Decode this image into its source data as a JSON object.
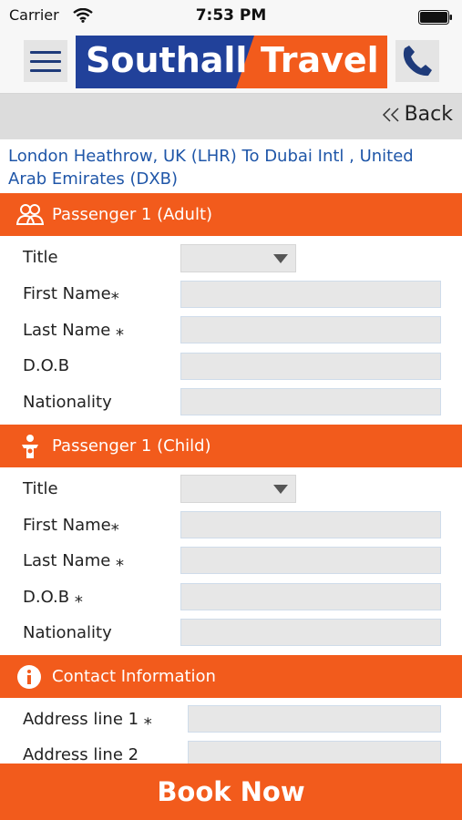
{
  "status_bar": {
    "carrier": "Carrier",
    "time": "7:53 PM"
  },
  "header": {
    "logo_word_1": "Southall",
    "logo_word_2": "Travel",
    "colors": {
      "brand_blue": "#21419a",
      "brand_orange": "#f25b1c"
    }
  },
  "nav": {
    "back_label": "Back"
  },
  "route": "London Heathrow, UK (LHR) To Dubai Intl , United Arab Emirates (DXB)",
  "sections": {
    "adult": {
      "title": "Passenger 1 (Adult)",
      "fields": {
        "title": "Title",
        "first_name": "First Name⁎",
        "last_name": "Last Name ⁎",
        "dob": "D.O.B",
        "nationality": "Nationality"
      }
    },
    "child": {
      "title": "Passenger 1 (Child)",
      "fields": {
        "title": "Title",
        "first_name": "First Name⁎",
        "last_name": "Last Name ⁎",
        "dob": "D.O.B ⁎",
        "nationality": "Nationality"
      }
    },
    "contact": {
      "title": "Contact Information",
      "fields": {
        "address_1": "Address line 1 ⁎",
        "address_2": "Address line 2"
      }
    }
  },
  "footer": {
    "book_label": "Book Now"
  }
}
